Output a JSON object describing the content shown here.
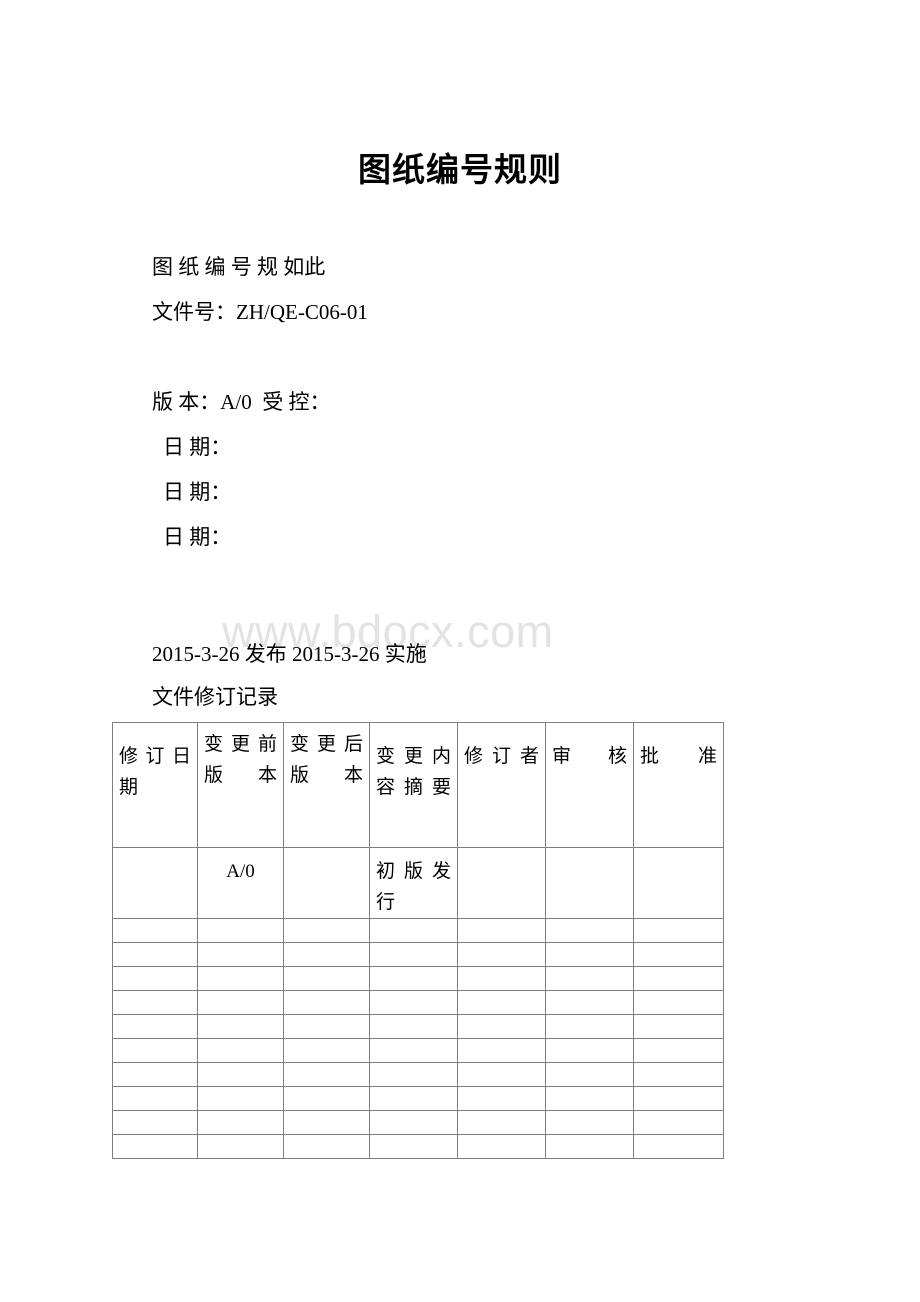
{
  "document": {
    "title": "图纸编号规则",
    "watermark": "www.bdocx.com"
  },
  "body": {
    "line1": "图 纸 编 号 规 如此",
    "line2": "文件号：ZH/QE-C06-01",
    "line3": "版 本：A/0  受 控：",
    "line4": "日 期：",
    "line5": "日 期：",
    "line6": "日 期："
  },
  "issue": {
    "release_line": "2015-3-26 发布 2015-3-26 实施",
    "record_heading": "文件修订记录"
  },
  "table": {
    "headers": [
      "修订日期",
      "变更前版本",
      "变更后版本",
      "变更内容摘要",
      "修订者",
      "审核",
      "批准"
    ],
    "rows": [
      [
        "",
        "A/0",
        "",
        "初版发行",
        "",
        "",
        ""
      ],
      [
        "",
        "",
        "",
        "",
        "",
        "",
        ""
      ],
      [
        "",
        "",
        "",
        "",
        "",
        "",
        ""
      ],
      [
        "",
        "",
        "",
        "",
        "",
        "",
        ""
      ],
      [
        "",
        "",
        "",
        "",
        "",
        "",
        ""
      ],
      [
        "",
        "",
        "",
        "",
        "",
        "",
        ""
      ],
      [
        "",
        "",
        "",
        "",
        "",
        "",
        ""
      ],
      [
        "",
        "",
        "",
        "",
        "",
        "",
        ""
      ],
      [
        "",
        "",
        "",
        "",
        "",
        "",
        ""
      ],
      [
        "",
        "",
        "",
        "",
        "",
        "",
        ""
      ],
      [
        "",
        "",
        "",
        "",
        "",
        "",
        ""
      ]
    ],
    "border_color": "#7f7f7f"
  }
}
